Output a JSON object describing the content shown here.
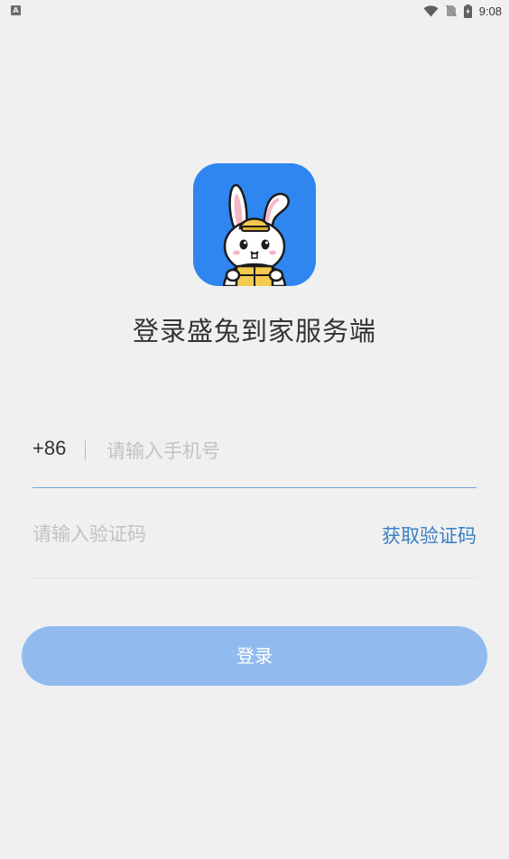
{
  "status_bar": {
    "time": "9:08",
    "left_icon": "A",
    "icons": [
      "wifi-icon",
      "no-sim-icon",
      "battery-charging-icon"
    ]
  },
  "app": {
    "title": "登录盛兔到家服务端",
    "logo_icon": "rabbit-logo-icon",
    "brand_color": "#2f86f0"
  },
  "login_form": {
    "country_code": "+86",
    "phone_placeholder": "请输入手机号",
    "code_placeholder": "请输入验证码",
    "get_code_label": "获取验证码",
    "login_label": "登录"
  },
  "colors": {
    "background": "#f0f0f0",
    "accent_link": "#3a7fc6",
    "login_button": "#91bbef",
    "active_underline": "#6ba4dd"
  }
}
